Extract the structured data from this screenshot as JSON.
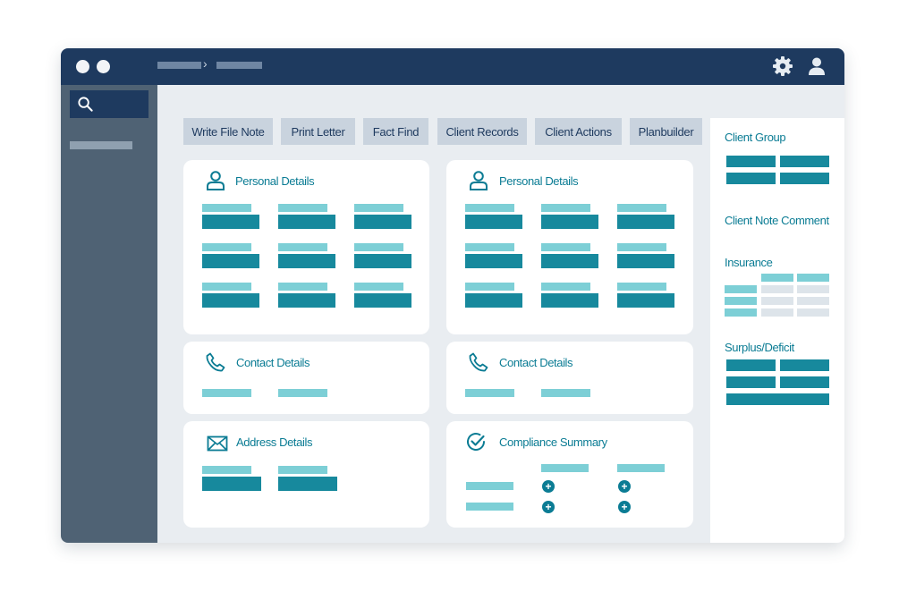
{
  "window": {
    "colors": {
      "titlebar": "#1e3a5f",
      "sidebar": "#4f6274",
      "background": "#e9edf1",
      "accent": "#0b7c94",
      "field_value": "#17899d",
      "field_label": "#7dcfd6"
    },
    "titlebar_icons": [
      "settings-gear-icon",
      "user-icon"
    ]
  },
  "sidebar": {
    "search_icon": "search-icon"
  },
  "toolbar": {
    "buttons": [
      {
        "label": "Write File Note"
      },
      {
        "label": "Print Letter"
      },
      {
        "label": "Fact Find"
      },
      {
        "label": "Client Records"
      },
      {
        "label": "Client Actions"
      },
      {
        "label": "Planbuilder"
      }
    ]
  },
  "cards": {
    "personal_left": {
      "title": "Personal Details",
      "icon": "person-icon"
    },
    "personal_right": {
      "title": "Personal Details",
      "icon": "person-icon"
    },
    "contact_left": {
      "title": "Contact Details",
      "icon": "phone-icon"
    },
    "contact_right": {
      "title": "Contact Details",
      "icon": "phone-icon"
    },
    "address": {
      "title": "Address Details",
      "icon": "envelope-icon"
    },
    "compliance": {
      "title": "Compliance Summary",
      "icon": "check-circle-icon",
      "add_icon": "plus-circle-icon"
    }
  },
  "right_panel": {
    "client_group": "Client Group",
    "client_note_comment": "Client Note Comment",
    "insurance": "Insurance",
    "surplus_deficit": "Surplus/Deficit"
  }
}
